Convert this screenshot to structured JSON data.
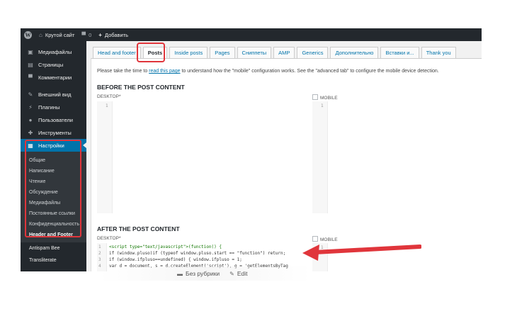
{
  "adminbar": {
    "site_name": "Крутой сайт",
    "comments_count": "0",
    "add_new": "Добавить"
  },
  "sidebar": {
    "items": [
      {
        "label": "Медиафайлы",
        "icon": "media-icon"
      },
      {
        "label": "Страницы",
        "icon": "pages-icon"
      },
      {
        "label": "Комментарии",
        "icon": "comments-icon"
      },
      {
        "label": "Внешний вид",
        "icon": "appearance-icon"
      },
      {
        "label": "Плагины",
        "icon": "plugins-icon"
      },
      {
        "label": "Пользователи",
        "icon": "users-icon"
      },
      {
        "label": "Инструменты",
        "icon": "tools-icon"
      },
      {
        "label": "Настройки",
        "icon": "settings-icon"
      }
    ],
    "submenu": [
      "Общие",
      "Написание",
      "Чтение",
      "Обсуждение",
      "Медиафайлы",
      "Постоянные ссылки",
      "Конфиденциальность",
      "Header and Footer"
    ],
    "after": [
      "Antispam Bee",
      "Transliterate"
    ]
  },
  "tabs": [
    "Head and footer",
    "Posts",
    "Inside posts",
    "Pages",
    "Сниппеты",
    "AMP",
    "Generics",
    "Дополнительно",
    "Вставки и...",
    "Thank you"
  ],
  "intro": {
    "before": "Please take the time to ",
    "link": "read this page",
    "after": " to understand how the \"mobile\" configuration works. See the \"advanced tab\" to configure the mobile device detection."
  },
  "before_section": {
    "title": "BEFORE THE POST CONTENT",
    "desktop_label": "DESKTOP*",
    "mobile_label": "MOBILE",
    "line1": "1"
  },
  "after_section": {
    "title": "AFTER THE POST CONTENT",
    "desktop_label": "DESKTOP*",
    "mobile_label": "MOBILE",
    "mobile_line1": "1",
    "code_lines": [
      {
        "n": "1",
        "text": "<script type=\"text/javascript\">(function() {"
      },
      {
        "n": "2",
        "text": "  if (window.pluso)if (typeof window.pluso.start == \"function\") return;"
      },
      {
        "n": "3",
        "text": "  if (window.ifpluso==undefined) { window.ifpluso = 1;"
      },
      {
        "n": "4",
        "text": "    var d = document, s = d.createElement('script'), g = 'getElementsByTag"
      }
    ]
  },
  "footer_meta": {
    "category": "Без рубрики",
    "edit": "Edit"
  },
  "colors": {
    "admin_dark": "#23282d",
    "active_blue": "#0073aa",
    "highlight_red": "#e0353b"
  }
}
